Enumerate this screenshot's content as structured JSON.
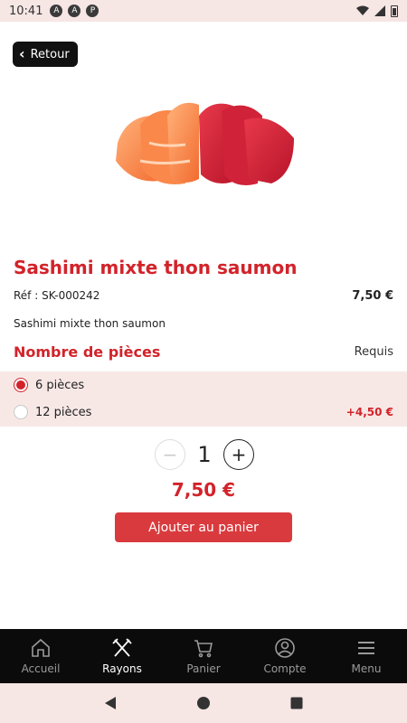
{
  "status_bar": {
    "time": "10:41"
  },
  "header": {
    "back_label": "Retour"
  },
  "product": {
    "title": "Sashimi mixte thon saumon",
    "ref": "Réf : SK-000242",
    "price": "7,50 €",
    "description": "Sashimi mixte thon saumon",
    "image_icon": "sashimi-image"
  },
  "options": {
    "title": "Nombre de pièces",
    "required_label": "Requis",
    "items": [
      {
        "label": "6 pièces",
        "extra": "",
        "selected": true
      },
      {
        "label": "12 pièces",
        "extra": "+4,50 €",
        "selected": false
      }
    ]
  },
  "quantity": {
    "value": "1",
    "minus_icon": "minus-icon",
    "plus_icon": "plus-icon"
  },
  "total": "7,50 €",
  "add_to_cart_label": "Ajouter au panier",
  "nav": {
    "items": [
      {
        "label": "Accueil",
        "icon": "home-icon",
        "active": false
      },
      {
        "label": "Rayons",
        "icon": "utensils-icon",
        "active": true
      },
      {
        "label": "Panier",
        "icon": "cart-icon",
        "active": false
      },
      {
        "label": "Compte",
        "icon": "user-icon",
        "active": false
      },
      {
        "label": "Menu",
        "icon": "menu-icon",
        "active": false
      }
    ]
  },
  "colors": {
    "brand_red": "#d2232a",
    "button_red": "#d93a3e",
    "option_bg": "#f7e8e6",
    "nav_bg": "#0b0b0b"
  }
}
